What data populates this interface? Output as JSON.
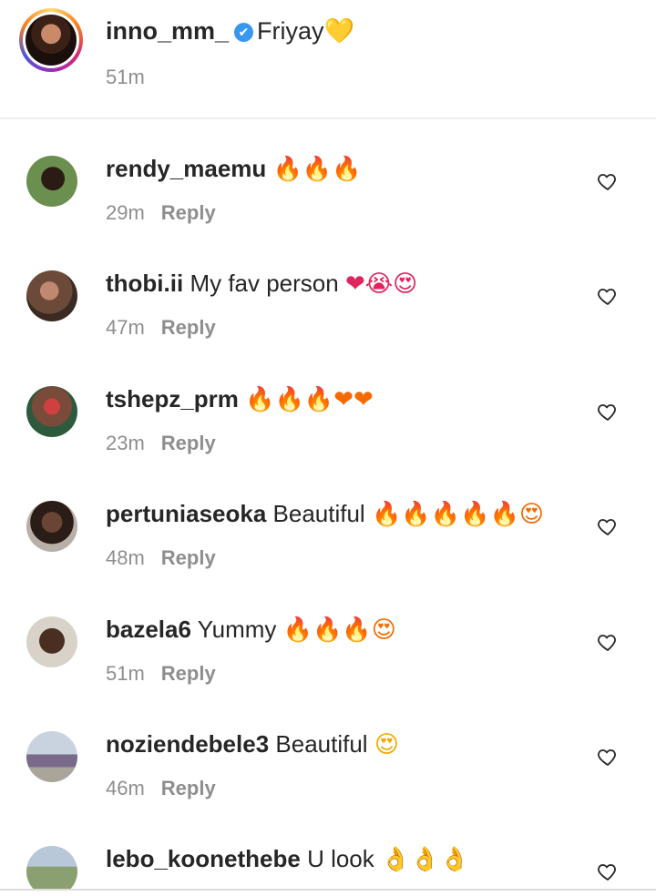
{
  "caption": {
    "username": "inno_mm_",
    "verified_mark": "✔",
    "text": "Friyay",
    "emoji": "💛",
    "time": "51m"
  },
  "comments": [
    {
      "username": "rendy_maemu",
      "text": "",
      "emoji": "🔥🔥🔥",
      "time": "29m",
      "reply": "Reply"
    },
    {
      "username": "thobi.ii",
      "text": "My fav person",
      "emoji": "❤😭😍",
      "time": "47m",
      "reply": "Reply"
    },
    {
      "username": "tshepz_prm",
      "text": "",
      "emoji": "🔥🔥🔥❤❤",
      "time": "23m",
      "reply": "Reply"
    },
    {
      "username": "pertuniaseoka",
      "text": "Beautiful",
      "emoji": "🔥🔥🔥🔥🔥😍",
      "time": "48m",
      "reply": "Reply"
    },
    {
      "username": "bazela6",
      "text": "Yummy",
      "emoji": "🔥🔥🔥😍",
      "time": "51m",
      "reply": "Reply"
    },
    {
      "username": "noziendebele3",
      "text": "Beautiful",
      "emoji": "😍",
      "time": "46m",
      "reply": "Reply"
    },
    {
      "username": "lebo_koonethebe",
      "text": "U look",
      "emoji": "👌👌👌",
      "time": "",
      "reply": ""
    }
  ],
  "icons": {
    "like": "heart-outline-icon",
    "verified": "verified-badge-icon"
  },
  "colors": {
    "text": "#262626",
    "muted": "#8e8e8e",
    "verified": "#3897f0",
    "divider": "#efefef"
  }
}
